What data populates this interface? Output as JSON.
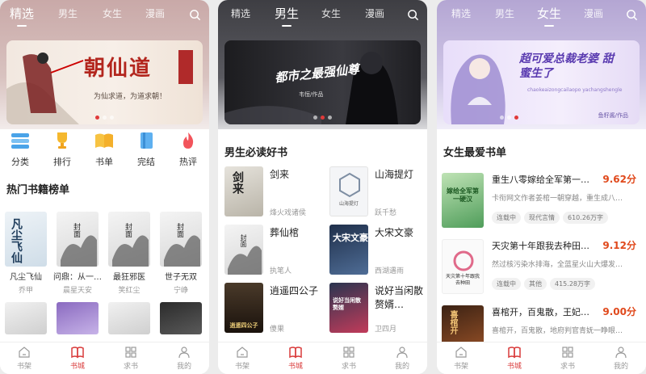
{
  "phones": [
    {
      "tabs": [
        "精选",
        "男生",
        "女生",
        "漫画"
      ],
      "active_tab": 0,
      "banner": {
        "title": "朝仙道",
        "subtitle": "为仙求道，为道求朝！"
      },
      "categories": [
        "分类",
        "排行",
        "书单",
        "完结",
        "热评"
      ],
      "section_title": "热门书籍榜单",
      "books": [
        {
          "title": "凡尘飞仙",
          "author": "乔甲",
          "cover_text": "凡尘飞仙"
        },
        {
          "title": "问鼎：从一等…",
          "author": "晨星天安",
          "cover_text": "封面"
        },
        {
          "title": "最狂邪医",
          "author": "笑红尘",
          "cover_text": "封面"
        },
        {
          "title": "世子无双",
          "author": "宁峥",
          "cover_text": "封面"
        }
      ],
      "nav": [
        "书架",
        "书城",
        "求书",
        "我的"
      ],
      "active_nav": 1
    },
    {
      "tabs": [
        "精选",
        "男生",
        "女生",
        "漫画"
      ],
      "active_tab": 1,
      "banner": {
        "title": "都市之最强仙尊",
        "subtitle": "韦恒/作品"
      },
      "section_title": "男生必读好书",
      "books": [
        {
          "title": "剑来",
          "author": "烽火戏诸侯",
          "cover_text": "剑来"
        },
        {
          "title": "山海提灯",
          "author": "跃千愁",
          "cover_text": "山海提灯"
        },
        {
          "title": "葬仙棺",
          "author": "执笔人",
          "cover_text": "封面"
        },
        {
          "title": "大宋文豪",
          "author": "西湖遇雨",
          "cover_text": "大宋文豪"
        },
        {
          "title": "逍遥四公子",
          "author": "傻果",
          "cover_text": "逍遥四公子"
        },
        {
          "title": "说好当闲散赘婿…",
          "author": "卫四月",
          "cover_text": "说好当闲散赘婿"
        }
      ],
      "nav": [
        "书架",
        "书城",
        "求书",
        "我的"
      ],
      "active_nav": 1
    },
    {
      "tabs": [
        "精选",
        "男生",
        "女生",
        "漫画"
      ],
      "active_tab": 2,
      "banner": {
        "title": "超可爱总裁老婆 甜蜜生了",
        "subtitle": "鱼籽酱/作品",
        "pinyin": "chaokeaizongcailaopo yachangshengle"
      },
      "section_title": "女生最爱书单",
      "books": [
        {
          "title": "重生八零嫁给全军第一…",
          "score": "9.62分",
          "desc": "卡衔网文作者姜棺一朝穿越，重生成八…",
          "tags": [
            "连载中",
            "现代言情",
            "610.26万字"
          ],
          "cover_text": "嫁给全军第一硬汉"
        },
        {
          "title": "天灾第十年跟我去种田…",
          "score": "9.12分",
          "desc": "然过核污染水排海，全蓝星火山大爆发…",
          "tags": [
            "连载中",
            "其他",
            "415.28万字"
          ],
          "cover_text": "天灾第十年跟我去种田"
        },
        {
          "title": "喜棺开，百鬼散，王妃…",
          "score": "9.00分",
          "desc": "喜棺开，百鬼散，地府判官青妩一睁眼…",
          "tags": [],
          "cover_text": "喜棺开"
        }
      ],
      "nav": [
        "书架",
        "书城",
        "求书",
        "我的"
      ],
      "active_nav": 1
    }
  ],
  "colors": {
    "accent": "#d93a3a",
    "score": "#e0491c"
  }
}
